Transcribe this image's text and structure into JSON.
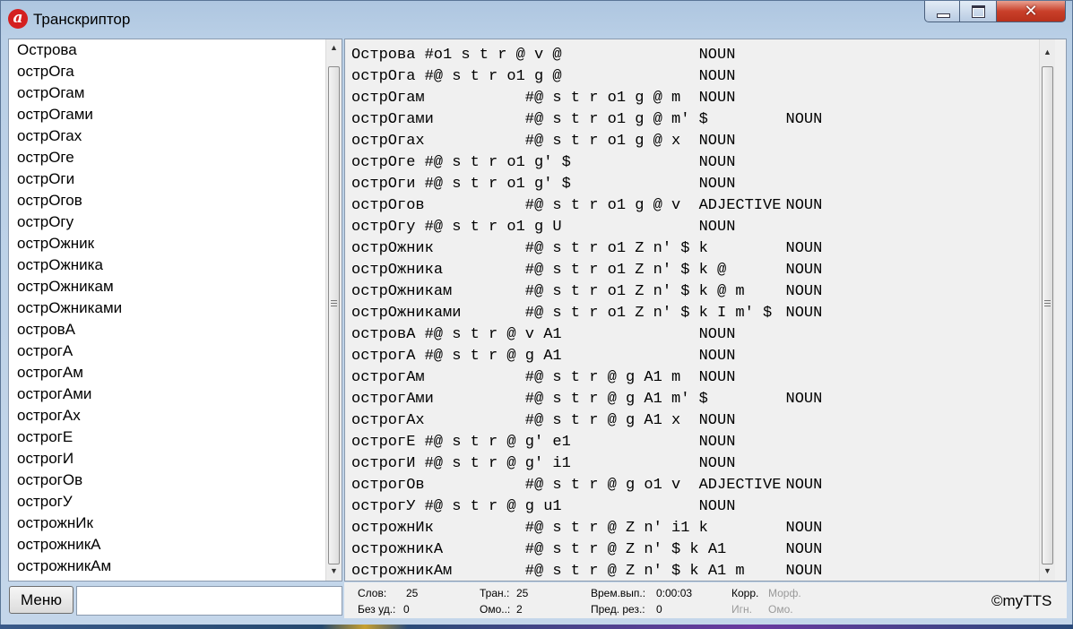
{
  "window": {
    "title": "Транскриптор",
    "app_icon": "a"
  },
  "words": [
    "Острова",
    "острОга",
    "острОгам",
    "острОгами",
    "острОгах",
    "острОге",
    "острОги",
    "острОгов",
    "острОгу",
    "острОжник",
    "острОжника",
    "острОжникам",
    "острОжниками",
    "островА",
    "острогА",
    "острогАм",
    "острогАми",
    "острогАх",
    "острогЕ",
    "острогИ",
    "острогОв",
    "острогУ",
    "острожнИк",
    "острожникА",
    "острожникАм"
  ],
  "transcriptions": [
    {
      "word": "Острова",
      "trans": "#o1 s t r @ v @",
      "tags": [
        "NOUN"
      ]
    },
    {
      "word": "острОга",
      "trans": "#@ s t r o1 g @",
      "tags": [
        "NOUN"
      ]
    },
    {
      "word": "острОгам",
      "trans": "#@ s t r o1 g @ m",
      "tags": [
        "NOUN"
      ]
    },
    {
      "word": "острОгами",
      "trans": "#@ s t r o1 g @ m' $",
      "tags": [
        "NOUN"
      ]
    },
    {
      "word": "острОгах",
      "trans": "#@ s t r o1 g @ x",
      "tags": [
        "NOUN"
      ]
    },
    {
      "word": "острОге",
      "trans": "#@ s t r o1 g' $",
      "tags": [
        "NOUN"
      ]
    },
    {
      "word": "острОги",
      "trans": "#@ s t r o1 g' $",
      "tags": [
        "NOUN"
      ]
    },
    {
      "word": "острОгов",
      "trans": "#@ s t r o1 g @ v",
      "tags": [
        "ADJECTIVE",
        "NOUN"
      ]
    },
    {
      "word": "острОгу",
      "trans": "#@ s t r o1 g U",
      "tags": [
        "NOUN"
      ]
    },
    {
      "word": "острОжник",
      "trans": "#@ s t r o1 Z n' $ k",
      "tags": [
        "NOUN"
      ]
    },
    {
      "word": "острОжника",
      "trans": "#@ s t r o1 Z n' $ k @",
      "tags": [
        "NOUN"
      ]
    },
    {
      "word": "острОжникам",
      "trans": "#@ s t r o1 Z n' $ k @ m",
      "tags": [
        "NOUN"
      ]
    },
    {
      "word": "острОжниками",
      "trans": "#@ s t r o1 Z n' $ k I m' $",
      "tags": [
        "NOUN"
      ]
    },
    {
      "word": "островА",
      "trans": "#@ s t r @ v A1",
      "tags": [
        "NOUN"
      ]
    },
    {
      "word": "острогА",
      "trans": "#@ s t r @ g A1",
      "tags": [
        "NOUN"
      ]
    },
    {
      "word": "острогАм",
      "trans": "#@ s t r @ g A1 m",
      "tags": [
        "NOUN"
      ]
    },
    {
      "word": "острогАми",
      "trans": "#@ s t r @ g A1 m' $",
      "tags": [
        "NOUN"
      ]
    },
    {
      "word": "острогАх",
      "trans": "#@ s t r @ g A1 x",
      "tags": [
        "NOUN"
      ]
    },
    {
      "word": "острогЕ",
      "trans": "#@ s t r @ g' e1",
      "tags": [
        "NOUN"
      ]
    },
    {
      "word": "острогИ",
      "trans": "#@ s t r @ g' i1",
      "tags": [
        "NOUN"
      ]
    },
    {
      "word": "острогОв",
      "trans": "#@ s t r @ g o1 v",
      "tags": [
        "ADJECTIVE",
        "NOUN"
      ]
    },
    {
      "word": "острогУ",
      "trans": "#@ s t r @ g u1",
      "tags": [
        "NOUN"
      ]
    },
    {
      "word": "острожнИк",
      "trans": "#@ s t r @ Z n' i1 k",
      "tags": [
        "NOUN"
      ]
    },
    {
      "word": "острожникА",
      "trans": "#@ s t r @ Z n' $ k A1",
      "tags": [
        "NOUN"
      ]
    },
    {
      "word": "острожникАм",
      "trans": "#@ s t r @ Z n' $ k A1 m",
      "tags": [
        "NOUN"
      ]
    }
  ],
  "menu": {
    "button_label": "Меню",
    "input_value": ""
  },
  "status": {
    "words_label": "Слов:",
    "words_value": "25",
    "no_stress_label": "Без уд.:",
    "no_stress_value": "0",
    "trans_label": "Тран.:",
    "trans_value": "25",
    "homo_label": "Омо..:",
    "homo_value": "2",
    "time_label": "Врем.вып.:",
    "time_value": "0:00:03",
    "prev_label": "Пред. рез.:",
    "prev_value": "0",
    "corr_label": "Корр.",
    "morph_label": "Морф.",
    "ign_label": "Игн.",
    "omo_label": "Омо.",
    "copyright": "©myTTS"
  },
  "icons": {
    "scroll_up": "triangle-up",
    "scroll_down": "triangle-down",
    "grip": "scroll-grip"
  }
}
